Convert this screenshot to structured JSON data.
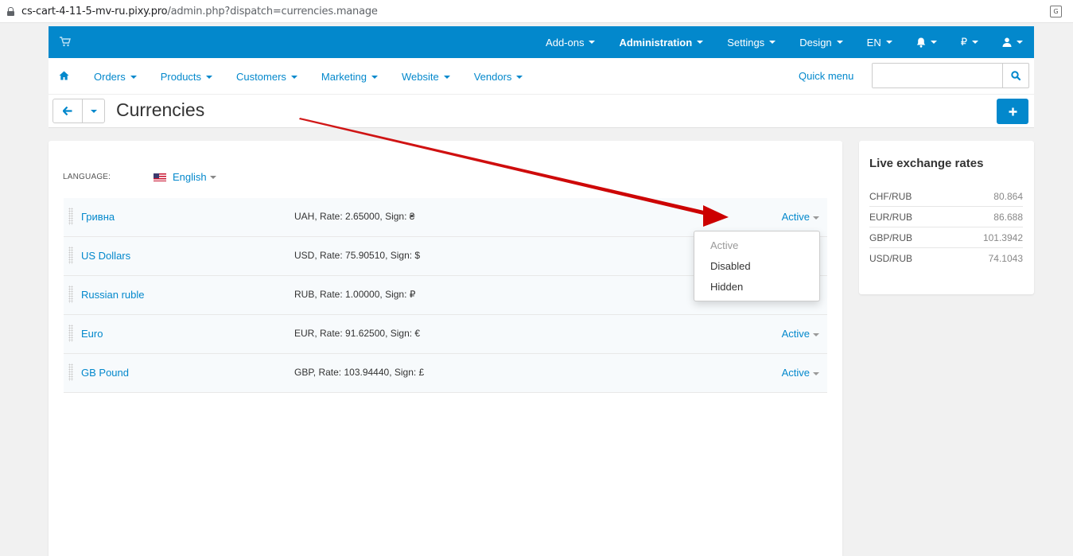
{
  "browser": {
    "url_host": "cs-cart-4-11-5-mv-ru.pixy.pro",
    "url_path": "/admin.php?dispatch=currencies.manage",
    "translate_icon": "translate-icon"
  },
  "topbar": {
    "color": "#0388cc",
    "menu": {
      "addons": "Add-ons",
      "administration": "Administration",
      "settings": "Settings",
      "design": "Design",
      "language": "EN",
      "currency": "₽"
    },
    "icons": [
      "cart-icon",
      "bell-icon",
      "user-icon"
    ]
  },
  "navbar": {
    "items": [
      "Orders",
      "Products",
      "Customers",
      "Marketing",
      "Website",
      "Vendors"
    ],
    "quick_menu": "Quick menu",
    "search_value": ""
  },
  "page": {
    "title": "Currencies"
  },
  "language": {
    "label": "LANGUAGE:",
    "selected": "English"
  },
  "currencies": [
    {
      "name": "Гривна",
      "info": "UAH, Rate: 2.65000, Sign: ₴",
      "status": "Active"
    },
    {
      "name": "US Dollars",
      "info": "USD, Rate: 75.90510, Sign: $",
      "status": ""
    },
    {
      "name": "Russian ruble",
      "info": "RUB, Rate: 1.00000, Sign: ₽",
      "status": ""
    },
    {
      "name": "Euro",
      "info": "EUR, Rate: 91.62500, Sign: €",
      "status": "Active"
    },
    {
      "name": "GB Pound",
      "info": "GBP, Rate: 103.94440, Sign: £",
      "status": "Active"
    }
  ],
  "status_dropdown": {
    "options": [
      "Active",
      "Disabled",
      "Hidden"
    ]
  },
  "sidebar": {
    "title": "Live exchange rates",
    "rates": [
      {
        "pair": "CHF/RUB",
        "value": "80.864"
      },
      {
        "pair": "EUR/RUB",
        "value": "86.688"
      },
      {
        "pair": "GBP/RUB",
        "value": "101.3942"
      },
      {
        "pair": "USD/RUB",
        "value": "74.1043"
      }
    ]
  },
  "annotation": {
    "arrow_color": "#cc0000"
  }
}
